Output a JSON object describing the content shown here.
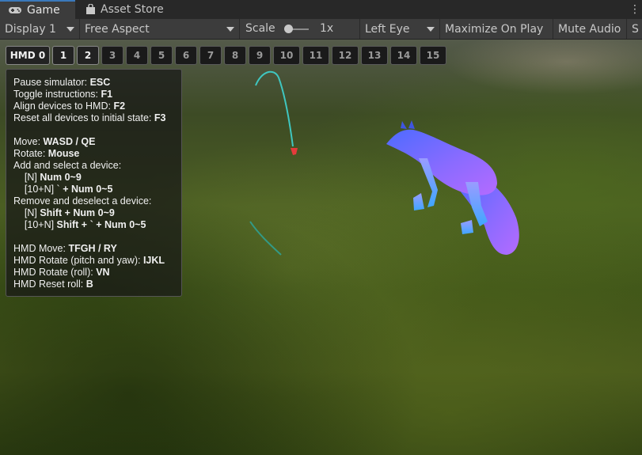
{
  "tabs": [
    {
      "label": "Game",
      "icon": "gamepad-icon",
      "active": true
    },
    {
      "label": "Asset Store",
      "icon": "shopping-bag-icon",
      "active": false
    }
  ],
  "toolbar": {
    "display": "Display 1",
    "aspect": "Free Aspect",
    "scale_label": "Scale",
    "scale_value": "1x",
    "eye": "Left Eye",
    "maximize": "Maximize On Play",
    "mute": "Mute Audio",
    "stats_partial": "S"
  },
  "device_buttons": [
    "HMD 0",
    "1",
    "2",
    "3",
    "4",
    "5",
    "6",
    "7",
    "8",
    "9",
    "10",
    "11",
    "12",
    "13",
    "14",
    "15"
  ],
  "device_buttons_active": [
    "HMD 0",
    "1",
    "2"
  ],
  "instructions": [
    {
      "text": "Pause simulator: ",
      "key": "ESC"
    },
    {
      "text": "Toggle instructions: ",
      "key": "F1"
    },
    {
      "text": "Align devices to HMD: ",
      "key": "F2"
    },
    {
      "text": "Reset all devices to initial state: ",
      "key": "F3"
    },
    {
      "text": "",
      "key": ""
    },
    {
      "text": "Move: ",
      "key": "WASD / QE"
    },
    {
      "text": "Rotate: ",
      "key": "Mouse"
    },
    {
      "text": "Add and select a device:",
      "key": ""
    },
    {
      "text": "    [N] ",
      "key": "Num 0~9"
    },
    {
      "text": "    [10+N] ` ",
      "key": "+ Num 0~5"
    },
    {
      "text": "Remove and deselect a device:",
      "key": ""
    },
    {
      "text": "    [N] ",
      "key": "Shift + Num 0~9"
    },
    {
      "text": "    [10+N] ",
      "key": "Shift + ` + Num 0~5"
    },
    {
      "text": "",
      "key": ""
    },
    {
      "text": "HMD Move: ",
      "key": "TFGH / RY"
    },
    {
      "text": "HMD Rotate (pitch and yaw): ",
      "key": "IJKL"
    },
    {
      "text": "HMD Rotate (roll): ",
      "key": "VN"
    },
    {
      "text": "HMD Reset roll: ",
      "key": "B"
    }
  ],
  "colors": {
    "tab_accent": "#3a79bb",
    "fox_start": "#4d6bff",
    "fox_end": "#b46bff",
    "controller_ray": "#3fc6c0",
    "controller": "#e53b3b"
  }
}
